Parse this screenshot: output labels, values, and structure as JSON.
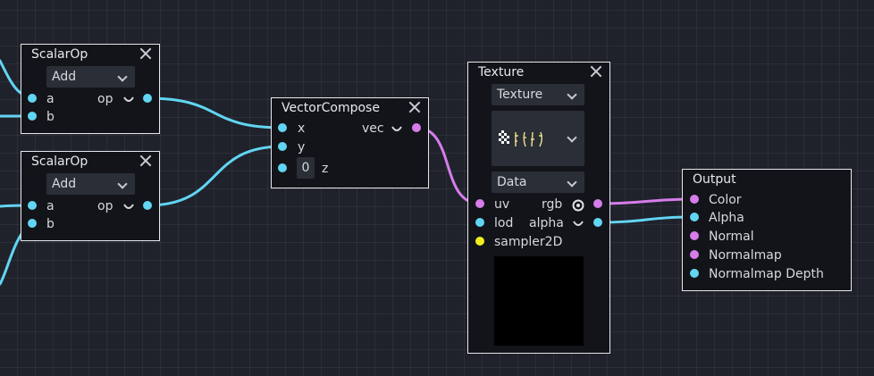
{
  "graph": {
    "nodes": {
      "scalarop_top": {
        "title": "ScalarOp",
        "op_select": "Add",
        "inputs": [
          "a",
          "b"
        ],
        "output": "op"
      },
      "scalarop_bottom": {
        "title": "ScalarOp",
        "op_select": "Add",
        "inputs": [
          "a",
          "b"
        ],
        "output": "op"
      },
      "vectorcompose": {
        "title": "VectorCompose",
        "inputs": [
          "x",
          "y",
          "z"
        ],
        "z_value": "0",
        "output": "vec"
      },
      "texture": {
        "title": "Texture",
        "source_select": "Texture",
        "type_select": "Data",
        "inputs": [
          "uv",
          "lod",
          "sampler2D"
        ],
        "outputs": [
          "rgb",
          "alpha"
        ]
      },
      "output": {
        "title": "Output",
        "inputs": [
          "Color",
          "Alpha",
          "Normal",
          "Normalmap",
          "Normalmap Depth"
        ]
      }
    },
    "colors": {
      "background": "#1f222b",
      "node_bg": "#121419",
      "node_border": "#e7e8eb",
      "scalar_port": "#61d5f2",
      "vector_port": "#d67dea",
      "sampler_port": "#f0ee21"
    },
    "icons": [
      "close-icon",
      "chevron-down-icon",
      "expand-icon",
      "eye-icon",
      "texture-thumbnail-icon"
    ]
  }
}
